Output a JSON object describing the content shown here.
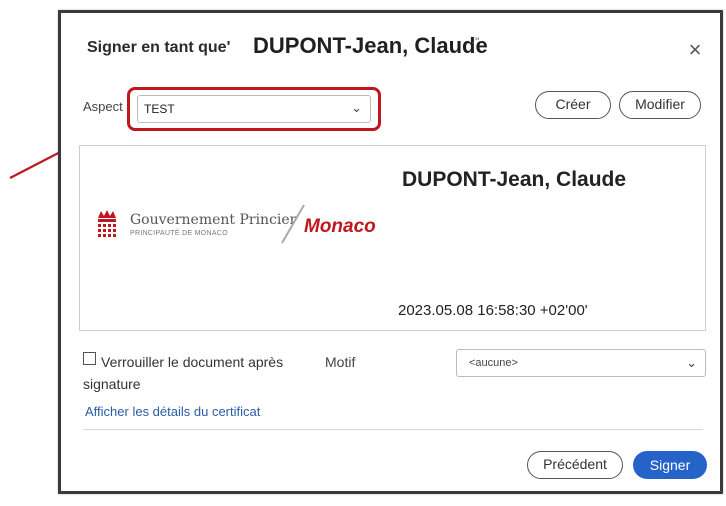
{
  "dialog": {
    "title": "Signer en tant que'",
    "signer_name": "DUPONT-Jean, Claude",
    "title_mark": "·\"",
    "close_glyph": "×"
  },
  "aspect": {
    "label": "Aspect",
    "selected": "TEST",
    "chevron": "⌄",
    "highlight_color": "#c0161d"
  },
  "buttons": {
    "create": "Créer",
    "modify": "Modifier",
    "previous": "Précédent",
    "sign": "Signer"
  },
  "preview": {
    "logo_line1": "Gouvernement Princier",
    "logo_line2": "PRINCIPAUTÉ DE MONACO",
    "logo_brand": "Monaco",
    "signer_name": "DUPONT-Jean, Claude",
    "date": "2023.05.08 16:58:30 +02'00'"
  },
  "options": {
    "lock_label": "Verrouiller le document après signature",
    "motif_label": "Motif",
    "motif_selected": "<aucune>",
    "cert_link": "Afficher les détails du certificat"
  },
  "colors": {
    "primary": "#2563c9",
    "annotation": "#c0161d"
  }
}
